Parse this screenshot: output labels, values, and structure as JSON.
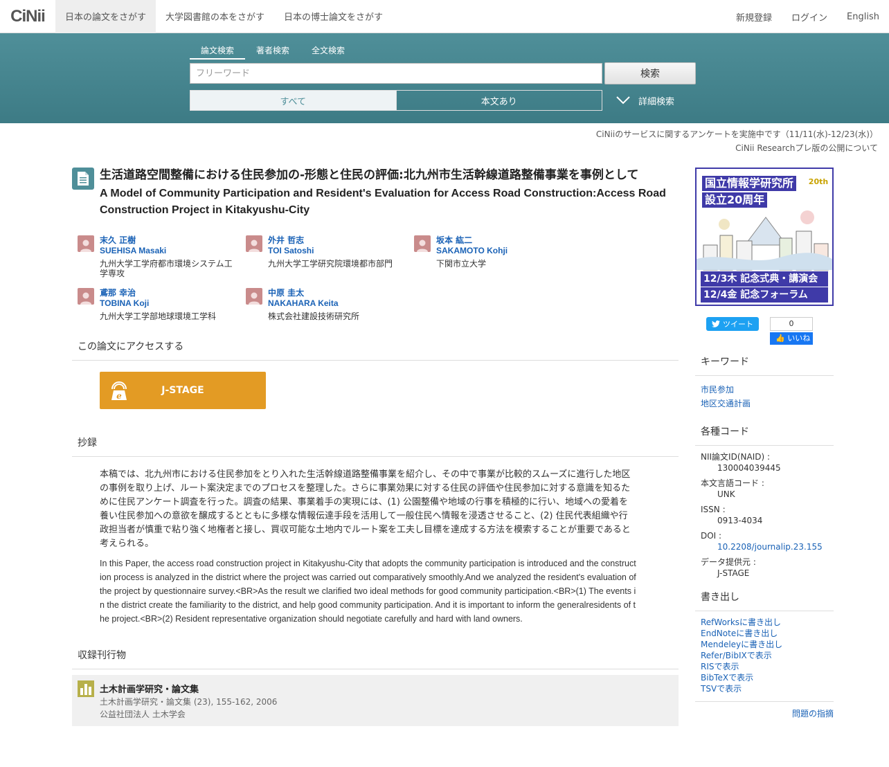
{
  "header": {
    "logo": "CiNii",
    "nav": [
      "日本の論文をさがす",
      "大学図書館の本をさがす",
      "日本の博士論文をさがす"
    ],
    "right": [
      "新規登録",
      "ログイン",
      "English"
    ]
  },
  "search": {
    "tabs": [
      "論文検索",
      "著者検索",
      "全文検索"
    ],
    "placeholder": "フリーワード",
    "button": "検索",
    "filter_all": "すべて",
    "filter_fulltext": "本文あり",
    "advanced": "詳細検索"
  },
  "notices": [
    "CiNiiのサービスに関するアンケートを実施中です（11/11(水)-12/23(水)）",
    "CiNii Researchプレ版の公開について"
  ],
  "paper": {
    "title_ja": "生活道路空間整備における住民参加の-形態と住民の評価:北九州市生活幹線道路整備事業を事例として",
    "title_en": "A Model of Community Participation and Resident's Evaluation for Access Road Construction:Access Road Construction Project in Kitakyushu-City",
    "authors": [
      {
        "name": "末久 正樹",
        "name_en": "SUEHISA Masaki",
        "aff": "九州大学工学府都市環境システム工学専攻"
      },
      {
        "name": "外井 哲志",
        "name_en": "TOI Satoshi",
        "aff": "九州大学工学研究院環境都市部門"
      },
      {
        "name": "坂本 紘二",
        "name_en": "SAKAMOTO Kohji",
        "aff": "下関市立大学"
      },
      {
        "name": "鳶那 幸治",
        "name_en": "TOBINA Koji",
        "aff": "九州大学工学部地球環境工学科"
      },
      {
        "name": "中原 圭太",
        "name_en": "NAKAHARA Keita",
        "aff": "株式会社建設技術研究所"
      }
    ],
    "access_heading": "この論文にアクセスする",
    "jstage_label": "J-STAGE",
    "abstract_heading": "抄録",
    "abstract_ja": "本稿では、北九州市における住民参加をとり入れた生活幹線道路整備事業を紹介し、その中で事業が比較的スムーズに進行した地区の事例を取り上げ、ルート案決定までのプロセスを整理した。さらに事業効果に対する住民の評価や住民参加に対する意識を知るために住民アンケート調査を行った。調査の結果、事業着手の実現には、(1) 公園整備や地域の行事を積極的に行い、地域への愛着を養い住民参加への意欲を醸成するとともに多様な情報伝達手段を活用して一般住民へ情報を浸透させること、(2) 住民代表組織や行政担当者が慎重で粘り強く地権者と接し、買収可能な土地内でルート案を工夫し目標を達成する方法を模索することが重要であると考えられる。",
    "abstract_en": "In this Paper, the access road construction project in Kitakyushu-City that adopts the community participation is introduced and the construction process is analyzed in the district where the project was carried out comparatively smoothly.And we analyzed the resident's evaluation of the project by questionnaire survey.<BR>As the result we clarified two ideal methods for good community participation.<BR>(1) The events in the district create the familiarity to the district, and help good community participation. And it is important to inform the generalresidents of the project.<BR>(2) Resident representative organization should negotiate carefully and hard with land owners.",
    "journal_heading": "収録刊行物",
    "journal_title": "土木計画学研究・論文集",
    "journal_detail": "土木計画学研究・論文集 (23), 155-162, 2006",
    "journal_publisher": "公益社団法人 土木学会"
  },
  "sidebar": {
    "banner_line1": "国立情報学研究所",
    "banner_line2": "設立20周年",
    "banner_line3": "12/3木 記念式典・講演会",
    "banner_line4": "12/4金 記念フォーラム",
    "tweet": "ツイート",
    "fb_count": "0",
    "fb_like": "いいね",
    "keywords_heading": "キーワード",
    "keywords": [
      "市民参加",
      "地区交通計画"
    ],
    "codes_heading": "各種コード",
    "codes": [
      {
        "key": "NII論文ID(NAID) :",
        "value": "130004039445"
      },
      {
        "key": "本文言語コード :",
        "value": "UNK"
      },
      {
        "key": "ISSN :",
        "value": "0913-4034"
      },
      {
        "key": "DOI :",
        "value": "10.2208/journalip.23.155"
      },
      {
        "key": "データ提供元 :",
        "value": "J-STAGE"
      }
    ],
    "export_heading": "書き出し",
    "exports": [
      "RefWorksに書き出し",
      "EndNoteに書き出し",
      "Mendeleyに書き出し",
      "Refer/BibIXで表示",
      "RISで表示",
      "BibTeXで表示",
      "TSVで表示"
    ],
    "report": "問題の指摘"
  },
  "colors": {
    "band": "#4f8f99",
    "link": "#1a62b6",
    "jstage": "#e39b24",
    "banner": "#3f3aa8"
  }
}
